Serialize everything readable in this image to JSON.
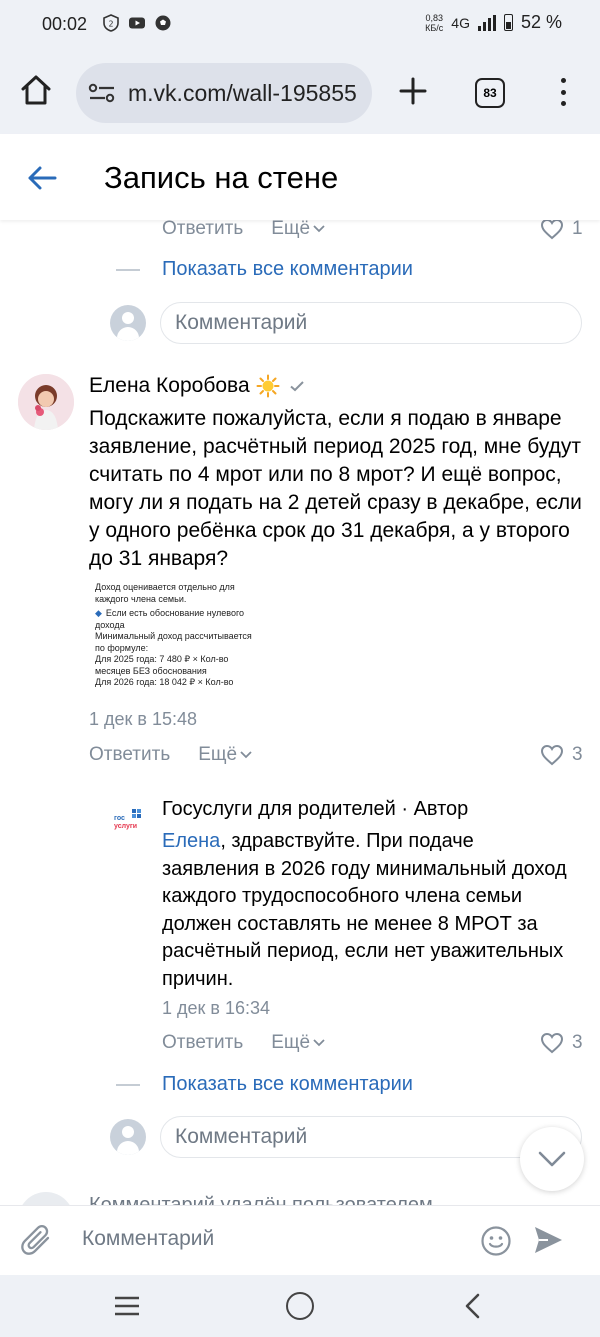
{
  "status_bar": {
    "time": "00:02",
    "speed": "0,83\nКБ/с",
    "network": "4G",
    "battery": "52 %",
    "icons": [
      "vpn-shield-icon",
      "youtube-icon",
      "football-icon"
    ]
  },
  "browser": {
    "url": "m.vk.com/wall-195855",
    "tab_count": "83"
  },
  "header": {
    "title": "Запись на стене"
  },
  "prev_comment": {
    "reply_label": "Ответить",
    "more_label": "Ещё",
    "like_count": "1",
    "show_all_label": "Показать все комментарии",
    "input_placeholder": "Комментарий"
  },
  "comment": {
    "author": "Елена Коробова",
    "text": "Подскажите пожалуйста, если я подаю в январе заявление, расчётный период 2025 год, мне будут считать по 4 мрот или по 8 мрот? И ещё вопрос, могу ли я подать на 2 детей сразу в декабре, если у одного ребёнка срок до 31 декабря, а у второго до 31 января?",
    "attachment_lines": [
      "Доход оценивается отдельно для",
      "каждого члена семьи.",
      "Если есть обоснование нулевого",
      "дохода",
      "Минимальный доход рассчитывается",
      "по формуле:",
      "Для 2025 года: 7 480 ₽ × Кол-во",
      "месяцев БЕЗ обоснования",
      "Для 2026 года: 18 042 ₽ × Кол-во"
    ],
    "date": "1 дек в 15:48",
    "reply_label": "Ответить",
    "more_label": "Ещё",
    "like_count": "3"
  },
  "reply": {
    "author": "Госуслуги для родителей · Автор",
    "mention": "Елена",
    "text": ", здравствуйте. При подаче заявления в 2026 году минимальный доход каждого трудоспособного члена семьи должен составлять не менее 8 МРОТ за расчётный период, если нет уважительных причин.",
    "date": "1 дек в 16:34",
    "reply_label": "Ответить",
    "more_label": "Ещё",
    "like_count": "3",
    "show_all_label": "Показать все комментарии",
    "input_placeholder": "Комментарий",
    "logo_text": [
      "гос",
      "услуги"
    ]
  },
  "deleted_comment": {
    "text": "Комментарий удалён пользователем"
  },
  "composer": {
    "placeholder": "Комментарий"
  },
  "colors": {
    "accent": "#2a6bb9",
    "secondary_text": "#818c99",
    "bar_background": "#eef1f6"
  }
}
